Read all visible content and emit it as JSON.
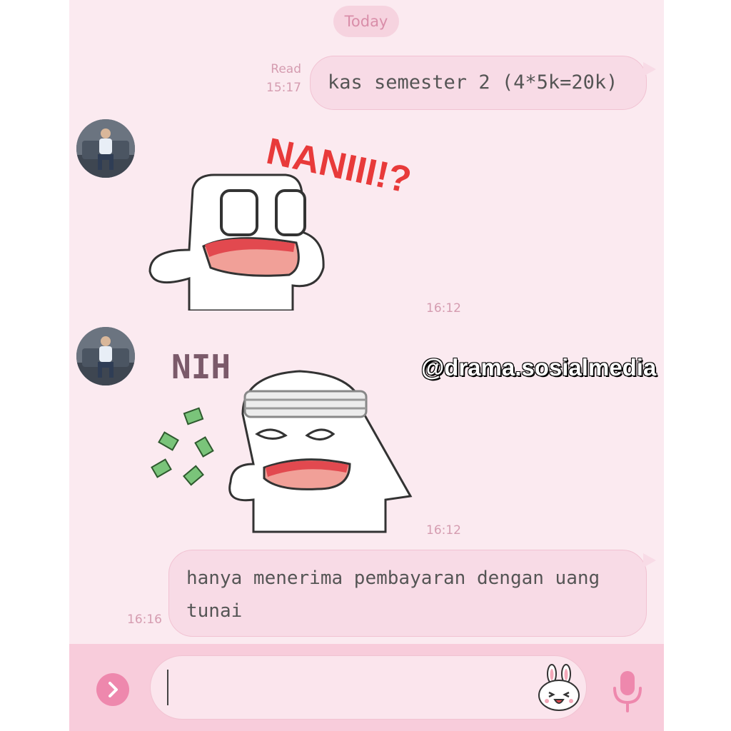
{
  "chat": {
    "date_label": "Today",
    "messages": [
      {
        "sender": "me",
        "status": "Read",
        "time": "15:17",
        "text": "kas semester 2 (4*5k=20k)"
      },
      {
        "sender": "other",
        "type": "sticker",
        "sticker_text": "NANIII!?",
        "time": "16:12"
      },
      {
        "sender": "other",
        "type": "sticker",
        "sticker_text": "NIH",
        "time": "16:12"
      },
      {
        "sender": "me",
        "time": "16:16",
        "text": "hanya menerima pembayaran dengan uang tunai"
      }
    ]
  },
  "watermark": "@drama.sosialmedia",
  "input": {
    "value": "",
    "placeholder": ""
  },
  "icons": {
    "expand": "chevron-right-icon",
    "emoji": "sticker-bunny-icon",
    "voice": "microphone-icon"
  },
  "colors": {
    "chat_background": "#fbeaf0",
    "bubble": "#f8dbe6",
    "accent": "#ee88ad",
    "input_bar": "#f8ccdb"
  }
}
